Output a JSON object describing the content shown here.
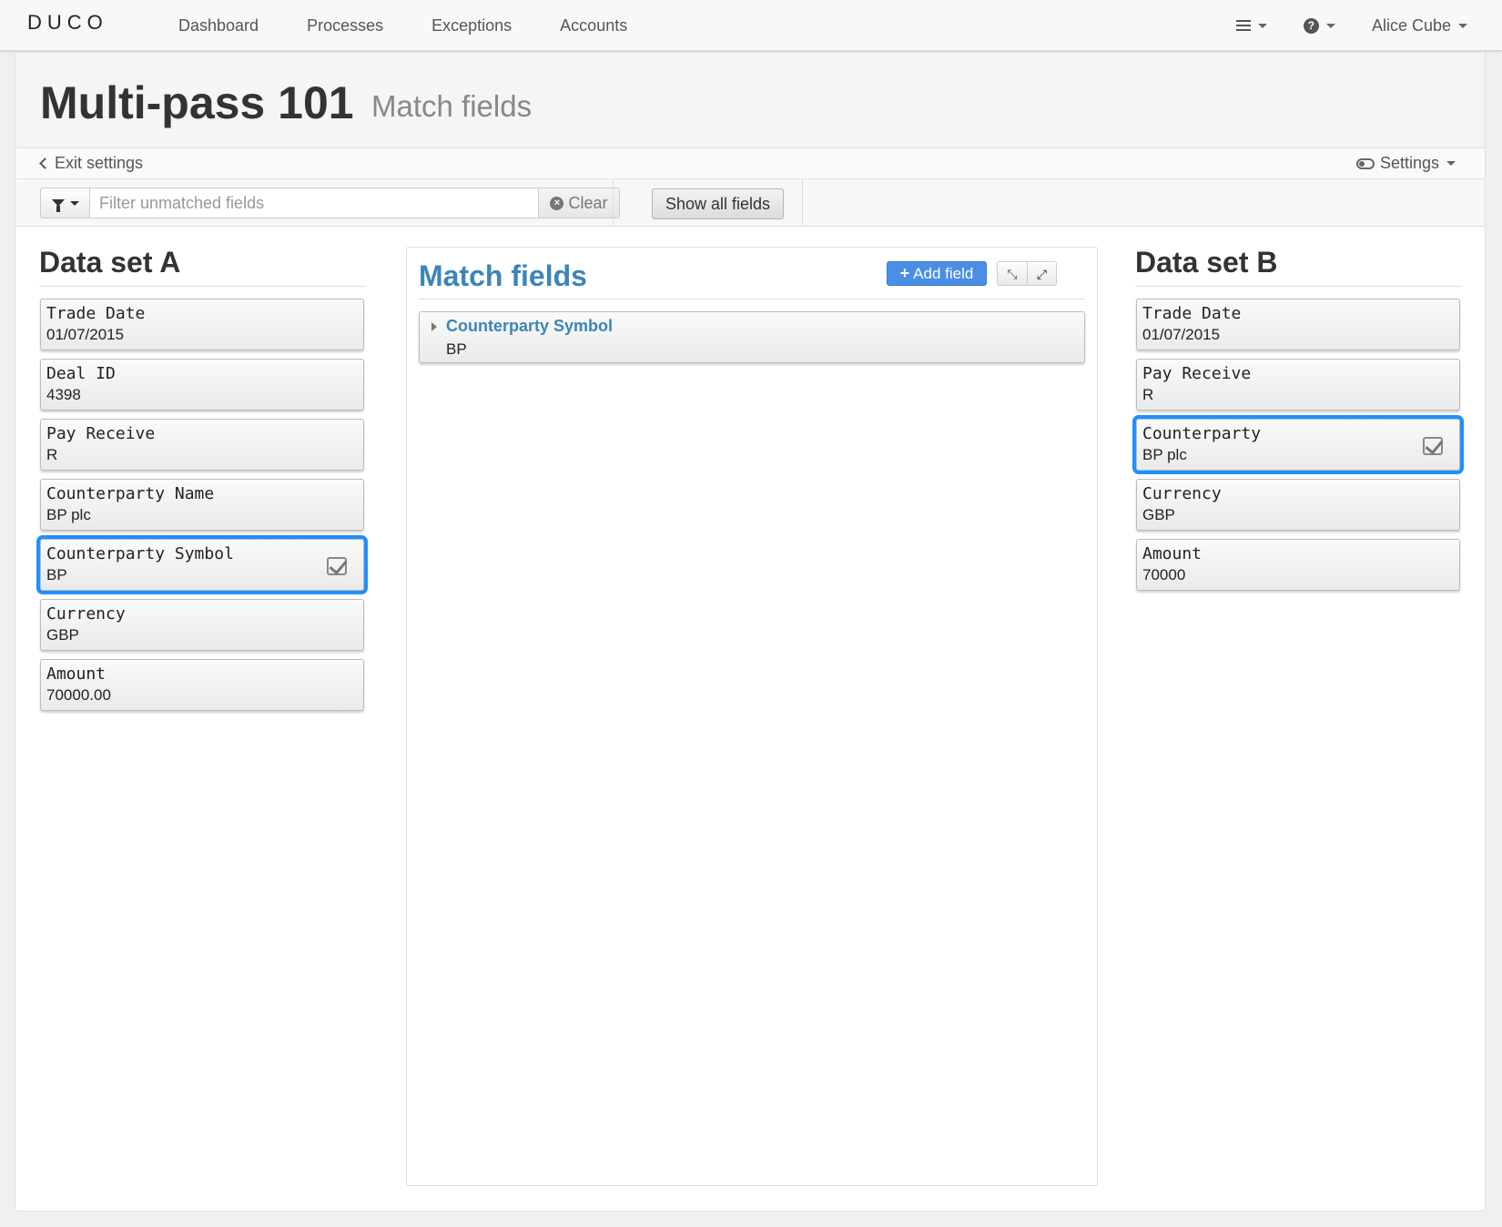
{
  "navbar": {
    "brand": "DUCO",
    "links": [
      "Dashboard",
      "Processes",
      "Exceptions",
      "Accounts"
    ],
    "user": "Alice Cube"
  },
  "header": {
    "title": "Multi-pass 101",
    "subtitle": "Match fields"
  },
  "settings_bar": {
    "exit_label": "Exit settings",
    "settings_label": "Settings"
  },
  "filter_bar": {
    "placeholder": "Filter unmatched fields",
    "value": "",
    "clear_label": "Clear",
    "show_all_label": "Show all fields"
  },
  "dataset_a": {
    "title": "Data set A",
    "fields": [
      {
        "name": "Trade Date",
        "value": "01/07/2015",
        "selected": false
      },
      {
        "name": "Deal ID",
        "value": "4398",
        "selected": false
      },
      {
        "name": "Pay Receive",
        "value": "R",
        "selected": false
      },
      {
        "name": "Counterparty Name",
        "value": "BP plc",
        "selected": false
      },
      {
        "name": "Counterparty Symbol",
        "value": "BP",
        "selected": true
      },
      {
        "name": "Currency",
        "value": "GBP",
        "selected": false
      },
      {
        "name": "Amount",
        "value": "70000.00",
        "selected": false
      }
    ]
  },
  "match_fields": {
    "title": "Match fields",
    "add_label": "Add field",
    "items": [
      {
        "name": "Counterparty Symbol",
        "value": "BP"
      }
    ]
  },
  "dataset_b": {
    "title": "Data set B",
    "fields": [
      {
        "name": "Trade Date",
        "value": "01/07/2015",
        "selected": false
      },
      {
        "name": "Pay Receive",
        "value": "R",
        "selected": false
      },
      {
        "name": "Counterparty",
        "value": "BP plc",
        "selected": true
      },
      {
        "name": "Currency",
        "value": "GBP",
        "selected": false
      },
      {
        "name": "Amount",
        "value": "70000",
        "selected": false
      }
    ]
  },
  "colors": {
    "accent_blue": "#3b85b8",
    "selection_outline": "#1e90ff",
    "add_button": "#4a8ee5"
  }
}
